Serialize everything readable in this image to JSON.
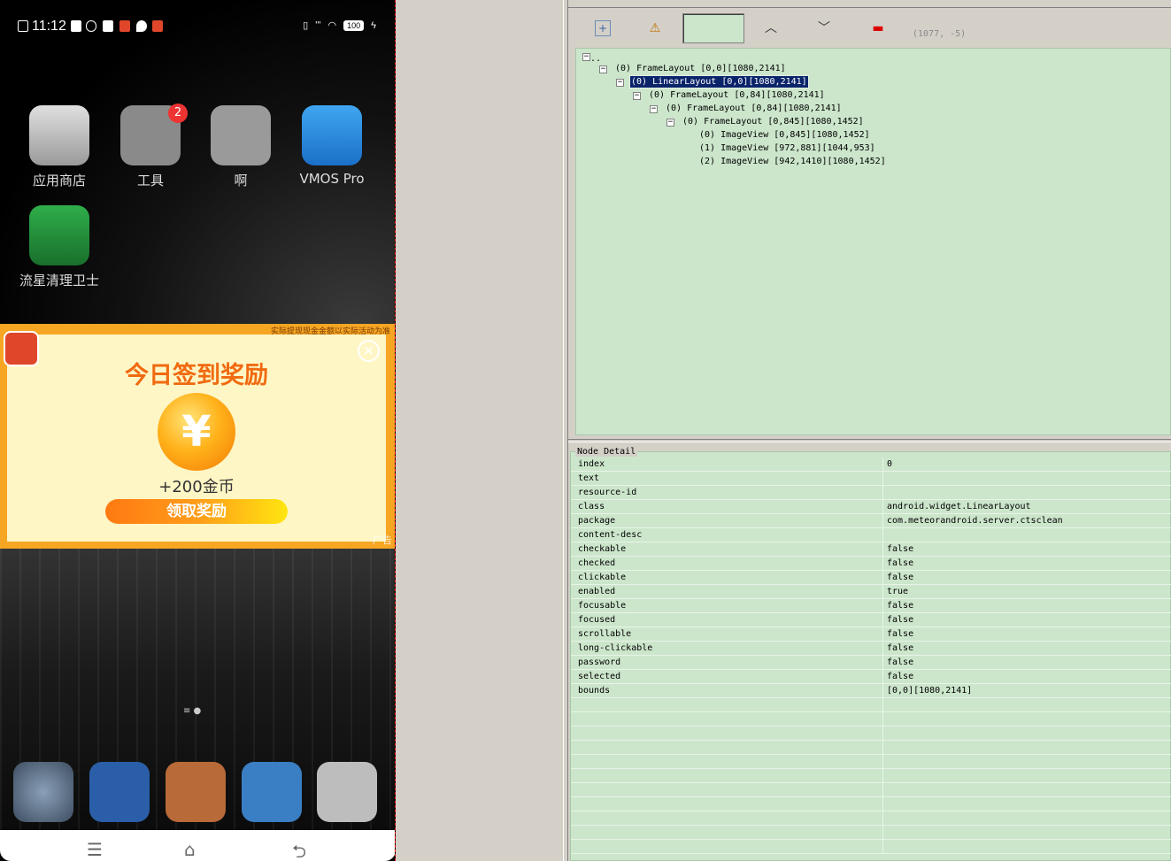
{
  "phone": {
    "status": {
      "time": "11:12",
      "network": "ʹʹʹ",
      "battery": "100"
    },
    "apps": [
      {
        "label": "应用商店"
      },
      {
        "label": "工具",
        "badge": "2"
      },
      {
        "label": "啊"
      },
      {
        "label": "VMOS Pro"
      },
      {
        "label": "流星清理卫士"
      }
    ],
    "ad": {
      "disclaimer": "实际提现现金金额以实际活动为准",
      "title": "今日签到奖励",
      "coin_symbol": "¥",
      "amount": "+200金币",
      "cta": "领取奖励",
      "tag": "广告",
      "close": "✕"
    }
  },
  "inspector": {
    "coords": "(1077, -5)",
    "tree": [
      {
        "text": "(0) FrameLayout [0,0][1080,2141]"
      },
      {
        "text": "(0) LinearLayout [0,0][1080,2141]",
        "selected": true
      },
      {
        "text": "(0) FrameLayout [0,84][1080,2141]"
      },
      {
        "text": "(0) FrameLayout [0,84][1080,2141]"
      },
      {
        "text": "(0) FrameLayout [0,845][1080,1452]"
      },
      {
        "text": "(0) ImageView [0,845][1080,1452]"
      },
      {
        "text": "(1) ImageView [972,881][1044,953]"
      },
      {
        "text": "(2) ImageView [942,1410][1080,1452]"
      }
    ],
    "detail_title": "Node Detail",
    "detail": [
      {
        "key": "index",
        "value": "0"
      },
      {
        "key": "text",
        "value": ""
      },
      {
        "key": "resource-id",
        "value": ""
      },
      {
        "key": "class",
        "value": "android.widget.LinearLayout"
      },
      {
        "key": "package",
        "value": "com.meteorandroid.server.ctsclean"
      },
      {
        "key": "content-desc",
        "value": ""
      },
      {
        "key": "checkable",
        "value": "false"
      },
      {
        "key": "checked",
        "value": "false"
      },
      {
        "key": "clickable",
        "value": "false"
      },
      {
        "key": "enabled",
        "value": "true"
      },
      {
        "key": "focusable",
        "value": "false"
      },
      {
        "key": "focused",
        "value": "false"
      },
      {
        "key": "scrollable",
        "value": "false"
      },
      {
        "key": "long-clickable",
        "value": "false"
      },
      {
        "key": "password",
        "value": "false"
      },
      {
        "key": "selected",
        "value": "false"
      },
      {
        "key": "bounds",
        "value": "[0,0][1080,2141]"
      }
    ]
  }
}
